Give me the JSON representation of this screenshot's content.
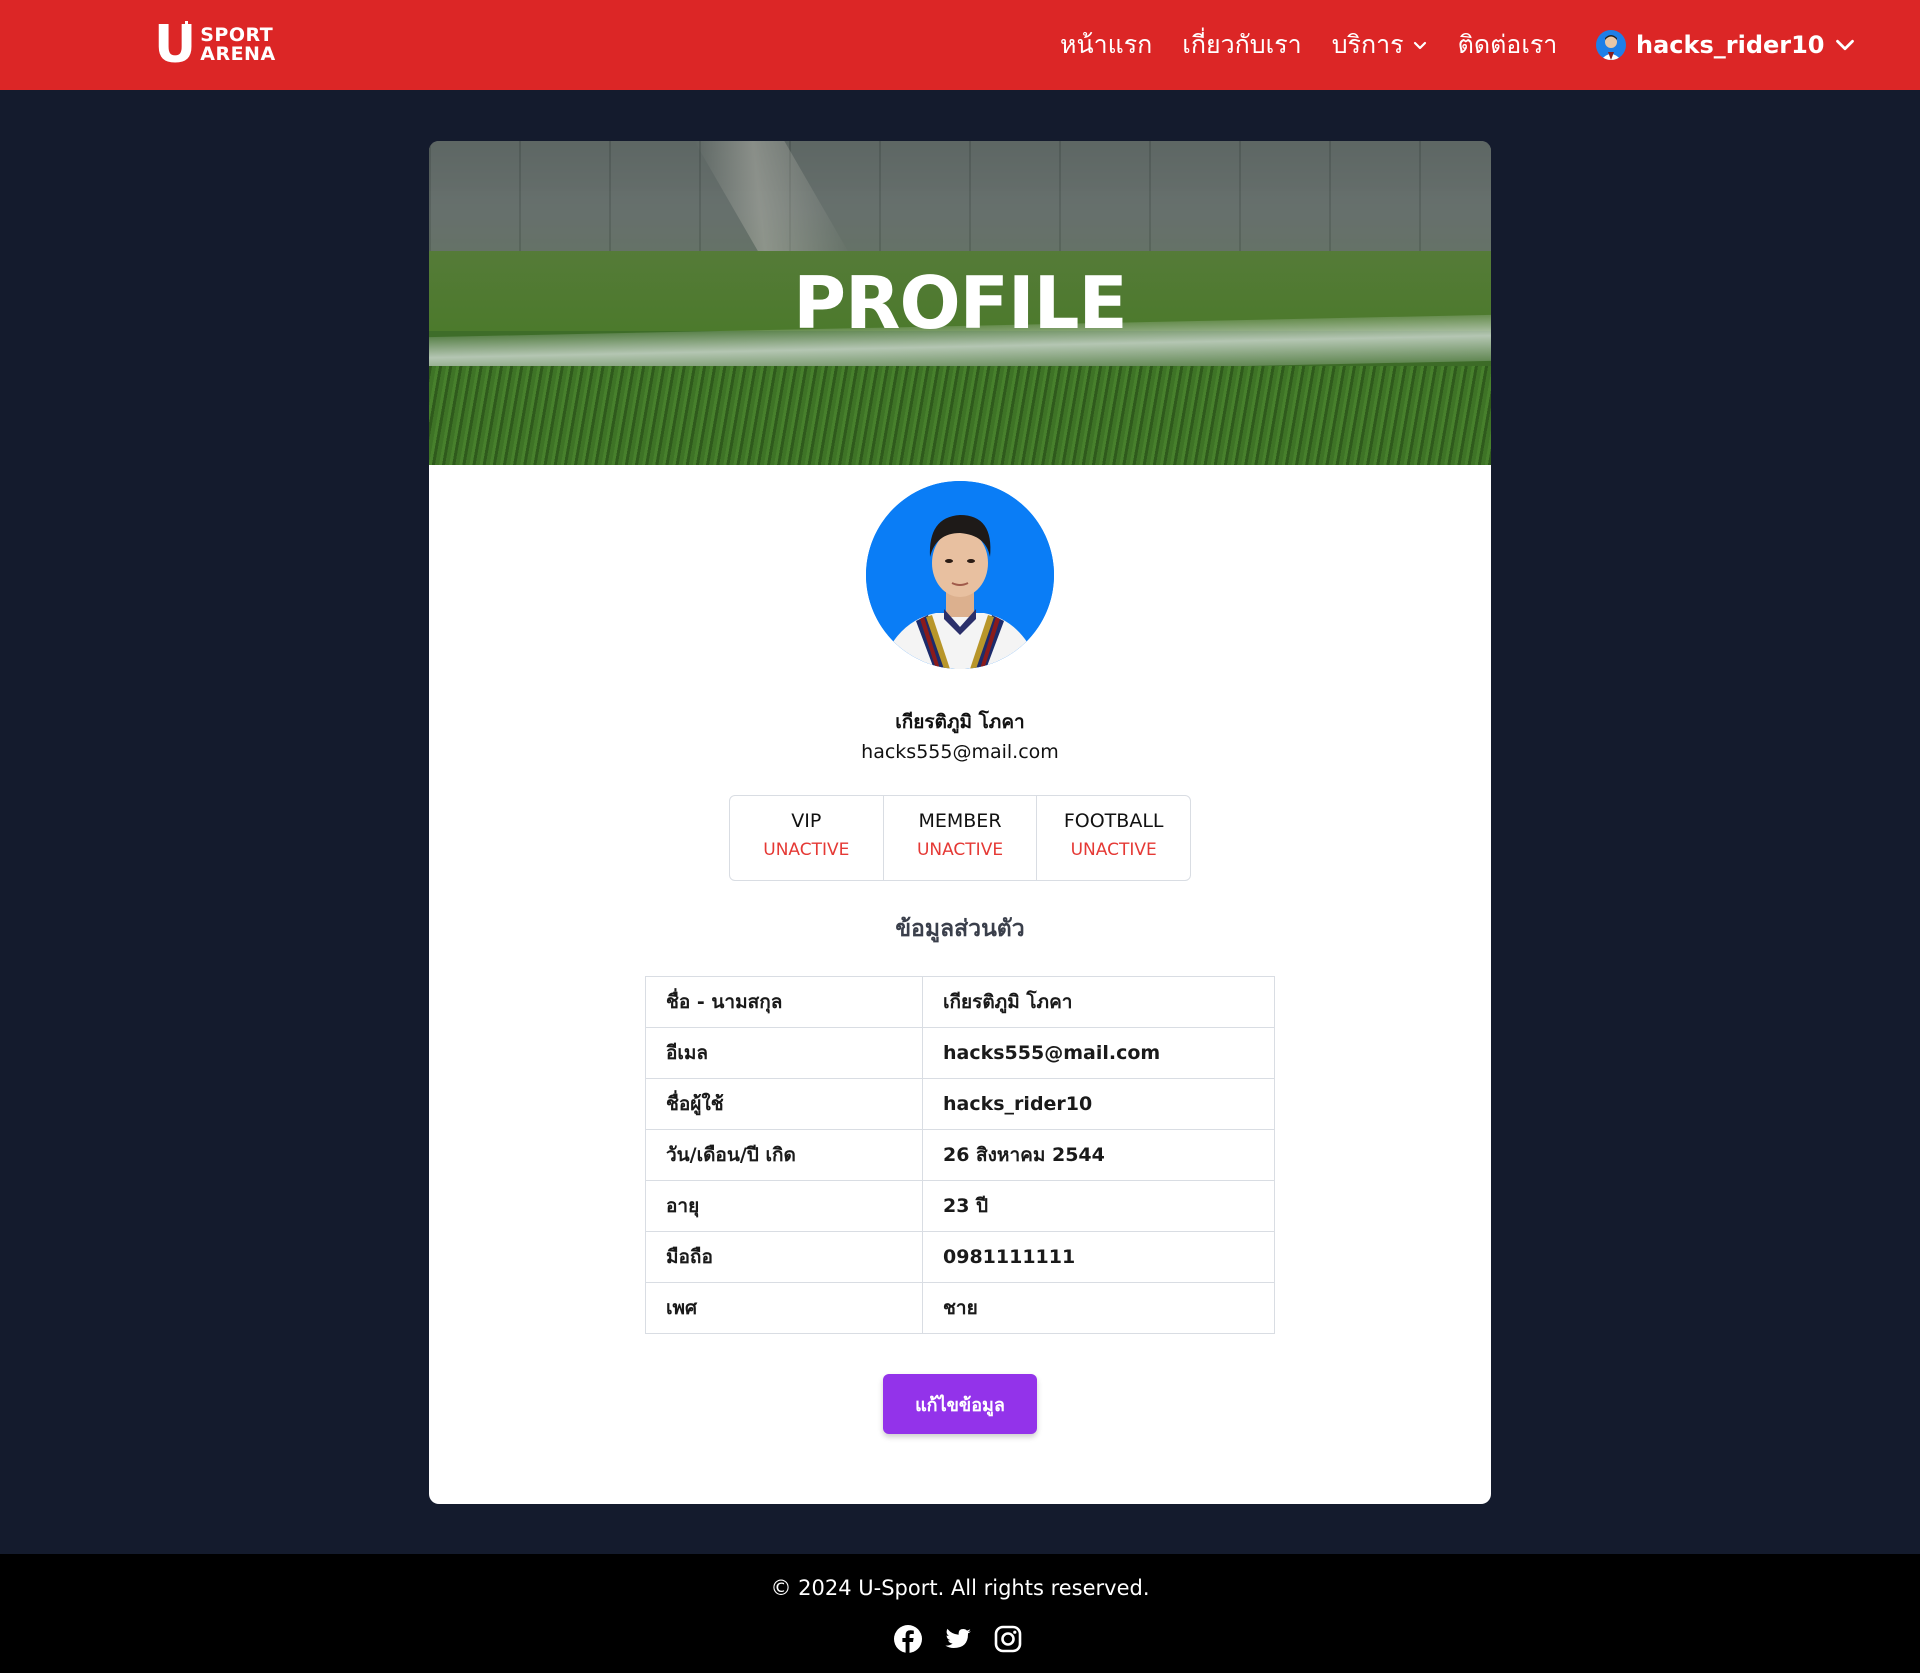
{
  "nav": {
    "logo": {
      "letter": "U",
      "line1": "SPORT",
      "line2": "ARENA"
    },
    "links": [
      {
        "label": "หน้าแรก"
      },
      {
        "label": "เกี่ยวกับเรา"
      },
      {
        "label": "บริการ"
      },
      {
        "label": "ติดต่อเรา"
      }
    ],
    "user": "hacks_rider10"
  },
  "banner": {
    "title": "PROFILE"
  },
  "profile": {
    "full_name": "เกียรติภูมิ โภคา",
    "email": "hacks555@mail.com",
    "statuses": [
      {
        "label": "VIP",
        "value": "UNACTIVE"
      },
      {
        "label": "MEMBER",
        "value": "UNACTIVE"
      },
      {
        "label": "FOOTBALL",
        "value": "UNACTIVE"
      }
    ]
  },
  "personal": {
    "title": "ข้อมูลส่วนตัว",
    "rows": [
      {
        "key": "ชื่อ - นามสกุล",
        "value": "เกียรติภูมิ โภคา"
      },
      {
        "key": "อีเมล",
        "value": "hacks555@mail.com"
      },
      {
        "key": "ชื่อผู้ใช้",
        "value": "hacks_rider10"
      },
      {
        "key": "วัน/เดือน/ปี เกิด",
        "value": "26 สิงหาคม 2544"
      },
      {
        "key": "อายุ",
        "value": "23 ปี"
      },
      {
        "key": "มือถือ",
        "value": "0981111111"
      },
      {
        "key": "เพศ",
        "value": "ชาย"
      }
    ]
  },
  "edit_button": "แก้ไขข้อมูล",
  "footer": {
    "copyright": "© 2024 U-Sport. All rights reserved.",
    "social_icons": [
      "facebook-icon",
      "twitter-icon",
      "instagram-icon"
    ]
  },
  "colors": {
    "nav_bg": "#dc2626",
    "page_bg": "#141b2d",
    "status_inactive": "#e53935",
    "button": "#9333ea"
  }
}
